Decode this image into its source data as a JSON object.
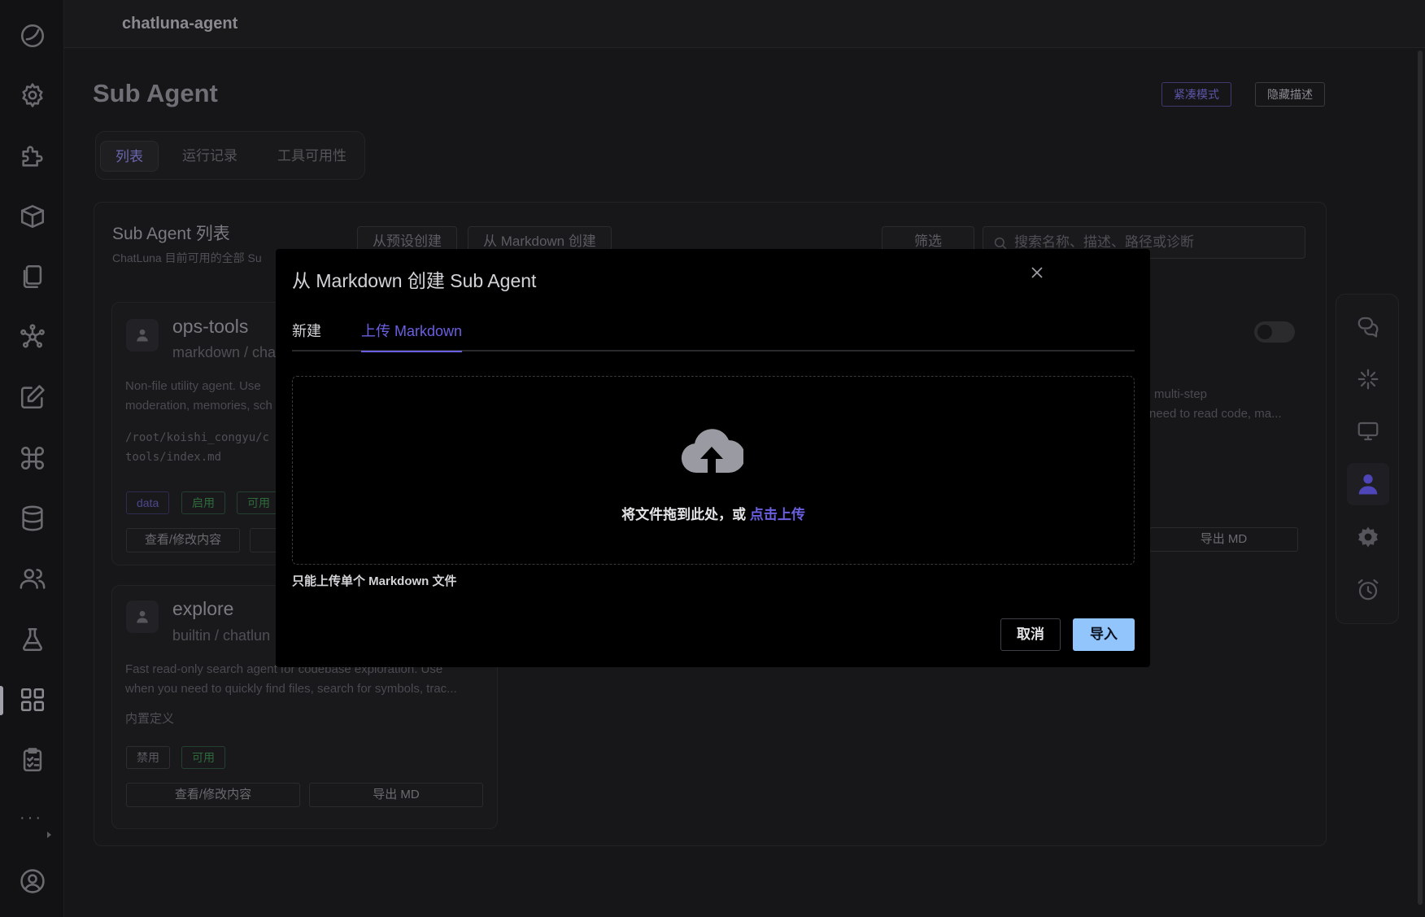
{
  "app": {
    "title": "chatluna-agent"
  },
  "page": {
    "title": "Sub Agent",
    "compact_mode": "紧凑模式",
    "hide_desc": "隐藏描述",
    "tabs": [
      {
        "label": "列表"
      },
      {
        "label": "运行记录"
      },
      {
        "label": "工具可用性"
      }
    ]
  },
  "panel": {
    "title": "Sub Agent 列表",
    "subtitle": "ChatLuna 目前可用的全部 Su",
    "create_from_preset": "从预设创建",
    "create_from_markdown": "从 Markdown 创建",
    "filter": "筛选",
    "search_placeholder": "搜索名称、描述、路径或诊断"
  },
  "cards": [
    {
      "name": "ops-tools",
      "meta": "markdown / cha",
      "desc_line1": "Non-file utility agent. Use",
      "desc_line2": "moderation, memories, sch",
      "path_line1": "/root/koishi_congyu/c",
      "path_line2": "tools/index.md",
      "badges": [
        "data",
        "启用",
        "可用"
      ],
      "view_button": "查看/修改内容"
    },
    {
      "name": "explore",
      "meta": "builtin / chatlun",
      "desc_line1": "Fast read-only search agent for codebase exploration. Use",
      "desc_line2": "when you need to quickly find files, search for symbols, trac...",
      "builtin_label": "内置定义",
      "badges": [
        "禁用",
        "可用"
      ],
      "view_button": "查看/修改内容",
      "export_button": "导出 MD"
    }
  ],
  "right_card": {
    "desc_line1": "multi-step",
    "desc_line2": "need to read code, ma...",
    "export_button": "导出 MD"
  },
  "dialog": {
    "title": "从 Markdown 创建 Sub Agent",
    "tabs": [
      {
        "label": "新建"
      },
      {
        "label": "上传 Markdown"
      }
    ],
    "drop_text": "将文件拖到此处，或 ",
    "drop_link": "点击上传",
    "tip": "只能上传单个 Markdown 文件",
    "cancel": "取消",
    "import": "导入"
  },
  "colors": {
    "accent": "#6a5fe0",
    "primary_button": "#93c5fd",
    "background": "#161618"
  }
}
